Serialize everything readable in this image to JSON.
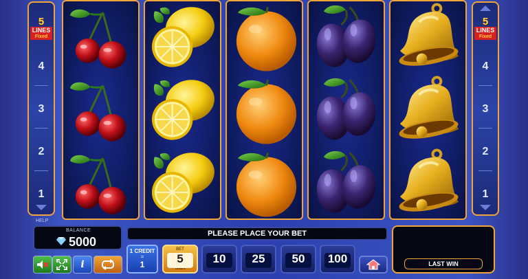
{
  "side_panels": {
    "left": {
      "lines_count": "5",
      "lines_word": "LINES",
      "fixed_word": "Fixed",
      "line_numbers": [
        "4",
        "3",
        "2",
        "1"
      ]
    },
    "right": {
      "lines_count": "5",
      "lines_word": "LINES",
      "fixed_word": "Fixed",
      "line_numbers": [
        "4",
        "3",
        "2",
        "1"
      ]
    }
  },
  "reels": [
    {
      "symbols": [
        "cherry-icon",
        "cherry-icon",
        "cherry-icon"
      ]
    },
    {
      "symbols": [
        "lemon-icon",
        "lemon-icon",
        "lemon-icon"
      ]
    },
    {
      "symbols": [
        "orange-icon",
        "orange-icon",
        "orange-icon"
      ]
    },
    {
      "symbols": [
        "plum-icon",
        "plum-icon",
        "plum-icon"
      ]
    },
    {
      "symbols": [
        "bell-icon",
        "bell-icon",
        "bell-icon"
      ]
    }
  ],
  "bottom": {
    "help_label": "HELP",
    "balance_label": "BALANCE",
    "balance_value": "5000",
    "message": "PLEASE PLACE YOUR BET",
    "credit": {
      "label": "1 CREDIT",
      "dot": "=",
      "value": "1"
    },
    "bets": [
      {
        "caption": "BET",
        "value": "5",
        "sub": "Start",
        "selected": true
      },
      {
        "caption": "",
        "value": "10",
        "sub": "",
        "selected": false
      },
      {
        "caption": "",
        "value": "25",
        "sub": "",
        "selected": false
      },
      {
        "caption": "",
        "value": "50",
        "sub": "",
        "selected": false
      },
      {
        "caption": "",
        "value": "100",
        "sub": "",
        "selected": false
      }
    ],
    "last_win_label": "LAST WIN",
    "info_label": "i"
  },
  "colors": {
    "frame": "#f0a43a",
    "background": "#2b3fae",
    "panel_dark": "#050812"
  }
}
